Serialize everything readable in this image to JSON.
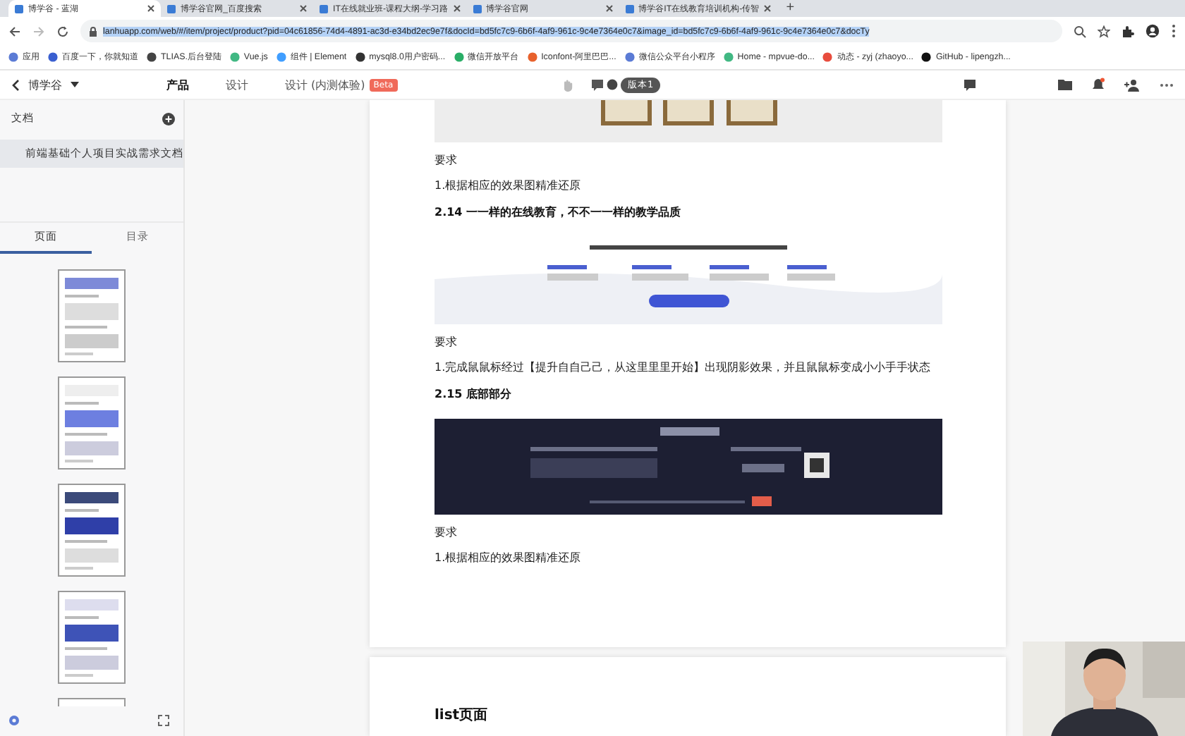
{
  "browser": {
    "tabs": [
      {
        "title": "博学谷 - 蓝湖",
        "selected": true
      },
      {
        "title": "博学谷官网_百度搜索",
        "selected": false
      },
      {
        "title": "IT在线就业班-课程大纲-学习路",
        "selected": false
      },
      {
        "title": "博学谷官网",
        "selected": false
      },
      {
        "title": "博学谷IT在线教育培训机构-传智",
        "selected": false
      }
    ],
    "new_tab": "+",
    "url": "lanhuapp.com/web/#/item/project/product?pid=04c61856-74d4-4891-ac3d-e34bd2ec9e7f&docId=bd5fc7c9-6b6f-4af9-961c-9c4e7364e0c7&image_id=bd5fc7c9-6b6f-4af9-961c-9c4e7364e0c7&docTy",
    "bookmarks": [
      "应用",
      "百度一下，你就知道",
      "TLIAS.后台登陆",
      "Vue.js",
      "组件 | Element",
      "mysql8.0用户密码...",
      "微信开放平台",
      "Iconfont-阿里巴巴...",
      "微信公众平台小程序",
      "Home - mpvue-do...",
      "动态 - zyj (zhaoyo...",
      "GitHub - lipengzh..."
    ]
  },
  "app_header": {
    "project": "博学谷",
    "tabs": [
      {
        "label": "产品",
        "selected": true
      },
      {
        "label": "设计",
        "selected": false
      },
      {
        "label": "设计 (内测体验)",
        "selected": false,
        "badge": "Beta"
      }
    ],
    "version": "版本1"
  },
  "sidebar": {
    "title": "文档",
    "documents": [
      {
        "name": "前端基础个人项目实战需求文档",
        "selected": true
      }
    ],
    "tabs": [
      {
        "label": "页面",
        "selected": true
      },
      {
        "label": "目录",
        "selected": false
      }
    ],
    "thumbnails": [
      {
        "kind": "picture"
      },
      {
        "kind": "picture"
      },
      {
        "kind": "picture"
      },
      {
        "kind": "picture"
      },
      {
        "kind": "picture"
      }
    ]
  },
  "document": {
    "blocks": [
      {
        "kind": "picture"
      },
      {
        "kind": "text",
        "text": "要求"
      },
      {
        "kind": "text",
        "text": "1.根据相应的效果图精准还原"
      },
      {
        "kind": "heading",
        "text": "2.14 一一样的在线教育，不不一一样的教学品质"
      },
      {
        "kind": "picture"
      },
      {
        "kind": "text",
        "text": "要求"
      },
      {
        "kind": "text",
        "text": "1.完成鼠鼠标经过【提升自自己己，从这里里里开始】出现阴影效果，并且鼠鼠标变成小小手手状态"
      },
      {
        "kind": "heading",
        "text": "2.15 底部部分"
      },
      {
        "kind": "picture"
      },
      {
        "kind": "text",
        "text": "要求"
      },
      {
        "kind": "text",
        "text": "1.根据相应的效果图精准还原"
      }
    ],
    "next_page_title": "list页面"
  },
  "webcam": {
    "kind": "picture"
  }
}
